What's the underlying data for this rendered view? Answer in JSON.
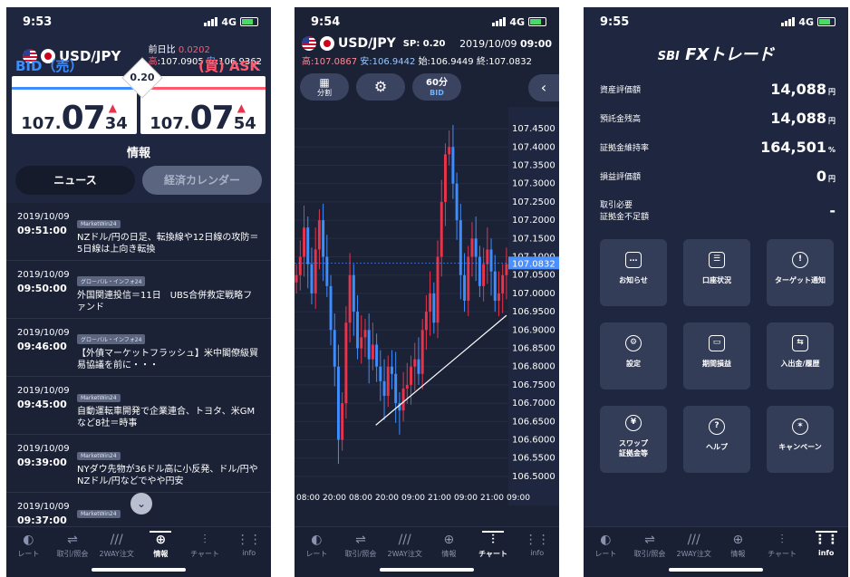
{
  "panel1": {
    "time": "9:53",
    "network": "4G",
    "pair": "USD/JPY",
    "change_label": "前日比",
    "change_value": "0.0202",
    "high_label": "高",
    "high_value": "107.0905",
    "low_label": "安",
    "low_value": "106.9362",
    "bid_label": "BID（売）",
    "ask_label": "(買) ASK",
    "spread": "0.20",
    "bid": {
      "small": "107.",
      "big": "07",
      "frac": "34"
    },
    "ask": {
      "small": "107.",
      "big": "07",
      "frac": "54"
    },
    "section_title": "情報",
    "seg_news": "ニュース",
    "seg_calendar": "経済カレンダー",
    "news": [
      {
        "date": "2019/10/09",
        "time": "09:51:00",
        "source": "MarketWin24",
        "title": "NZドル/円の日足、転換線や12日線の攻防＝5日線は上向き転換"
      },
      {
        "date": "2019/10/09",
        "time": "09:50:00",
        "source": "グローバル・インフォ24",
        "title": "外国関連投信＝11日　UBS合併救定戦略ファンド"
      },
      {
        "date": "2019/10/09",
        "time": "09:46:00",
        "source": "グローバル・インフォ24",
        "title": "【外債マーケットフラッシュ】米中閣僚級貿易協議を前に・・・"
      },
      {
        "date": "2019/10/09",
        "time": "09:45:00",
        "source": "MarketWin24",
        "title": "自動運転車開発で企業連合、トヨタ、米GMなど8社＝時事"
      },
      {
        "date": "2019/10/09",
        "time": "09:39:00",
        "source": "MarketWin24",
        "title": "NYダウ先物が36ドル高に小反発、ドル/円やNZドル/円などでやや円安"
      },
      {
        "date": "2019/10/09",
        "time": "09:37:00",
        "source": "MarketWin24",
        "title": ""
      }
    ]
  },
  "panel2": {
    "time": "9:54",
    "network": "4G",
    "pair": "USD/JPY",
    "spread": "SP: 0.20",
    "date": "2019/10/09",
    "clock": "09:00",
    "high": "高:107.0867",
    "low": "安:106.9442",
    "open": "始:106.9449",
    "close": "終:107.0832",
    "btn_split": "分割",
    "btn_interval": "60分",
    "btn_bid": "BID"
  },
  "panel3": {
    "time": "9:55",
    "network": "4G",
    "logo_sbi": "SBI",
    "logo_fx": "FXトレード",
    "rows": [
      {
        "label": "資産評価額",
        "value": "14,088",
        "unit": "円"
      },
      {
        "label": "預託金残高",
        "value": "14,088",
        "unit": "円"
      },
      {
        "label": "証拠金維持率",
        "value": "164,501",
        "unit": "%"
      },
      {
        "label": "損益評価額",
        "value": "0",
        "unit": "円"
      }
    ],
    "shortfall_label1": "取引必要",
    "shortfall_label2": "証拠金不足額",
    "shortfall_value": "-",
    "menu": [
      {
        "label": "お知らせ",
        "icon": "message-icon"
      },
      {
        "label": "口座状況",
        "icon": "account-icon"
      },
      {
        "label": "ターゲット通知",
        "icon": "alert-icon"
      },
      {
        "label": "設定",
        "icon": "gear-icon"
      },
      {
        "label": "期間損益",
        "icon": "tablet-icon"
      },
      {
        "label": "入出金/履歴",
        "icon": "transfer-icon"
      },
      {
        "label": "スワップ",
        "label2": "証拠金等",
        "icon": "yen-icon"
      },
      {
        "label": "ヘルプ",
        "icon": "help-icon"
      },
      {
        "label": "キャンペーン",
        "icon": "party-icon"
      }
    ]
  },
  "tabs": [
    "レート",
    "取引/照会",
    "2WAY注文",
    "情報",
    "チャート",
    "info"
  ],
  "colors": {
    "bg": "#1f2740",
    "bid": "#3e8dff",
    "ask": "#ff5a6e",
    "candle_up": "#e8334a",
    "candle_down": "#3e8dff"
  },
  "chart_data": {
    "type": "candlestick",
    "pair": "USD/JPY",
    "interval": "60分",
    "yticks": [
      "107.4500",
      "107.4000",
      "107.3500",
      "107.3000",
      "107.2500",
      "107.2000",
      "107.1500",
      "107.1000",
      "107.0500",
      "107.0000",
      "106.9500",
      "106.9000",
      "106.8500",
      "106.8000",
      "106.7500",
      "106.7000",
      "106.6500",
      "106.6000",
      "106.5500",
      "106.5000"
    ],
    "ylim": [
      106.48,
      107.47
    ],
    "xticks": [
      "08:00",
      "20:00",
      "08:00",
      "20:00",
      "09:00",
      "21:00",
      "09:00",
      "21:00",
      "09:00"
    ],
    "last_price": "107.0832",
    "close": [
      107.05,
      107.1,
      107.18,
      107.08,
      107.0,
      107.12,
      107.2,
      107.1,
      107.02,
      106.9,
      106.8,
      106.6,
      106.7,
      106.92,
      107.05,
      106.95,
      106.85,
      106.88,
      106.9,
      106.82,
      106.86,
      106.8,
      106.76,
      106.72,
      106.8,
      106.78,
      106.7,
      106.68,
      106.74,
      106.75,
      106.8,
      106.82,
      106.78,
      106.9,
      106.95,
      107.0,
      106.92,
      107.1,
      107.25,
      107.38,
      107.4,
      107.3,
      107.2,
      107.05,
      106.98,
      107.1,
      107.15,
      107.1,
      107.02,
      107.08,
      107.12,
      107.06,
      106.98,
      107.0,
      107.05,
      107.08
    ],
    "trendline": {
      "from": 106.64,
      "to": 106.94
    }
  }
}
